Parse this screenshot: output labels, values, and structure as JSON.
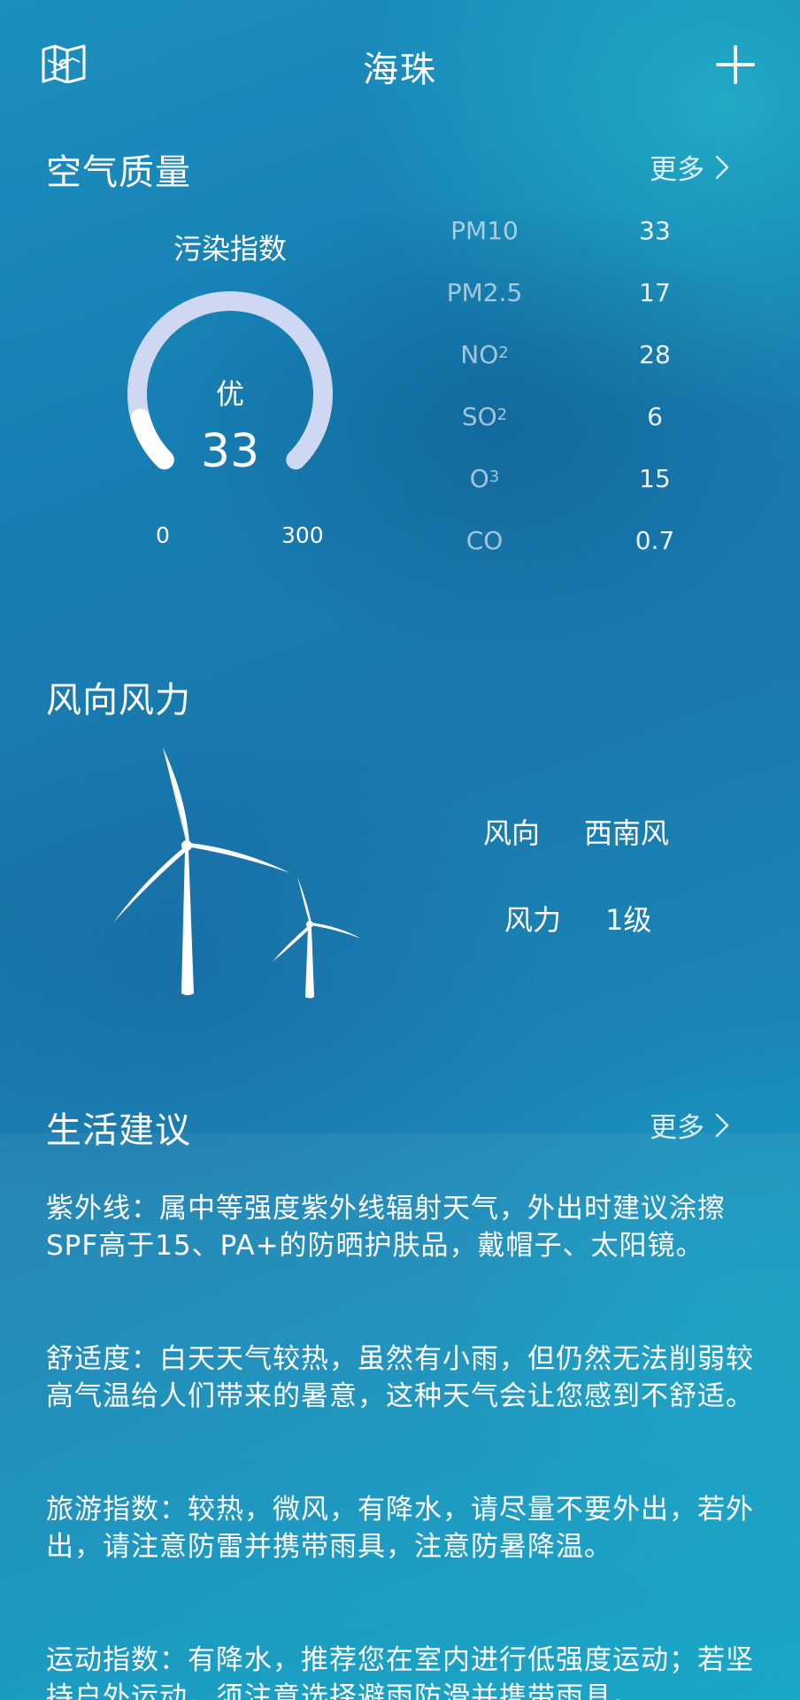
{
  "header": {
    "title": "海珠"
  },
  "air_quality": {
    "section_title": "空气质量",
    "more_label": "更多",
    "index_label": "污染指数",
    "level": "优",
    "value": "33",
    "gauge_min": "0",
    "gauge_max": "300",
    "gauge_fraction": 0.11,
    "pollutants": [
      {
        "name": "PM10",
        "sub": "",
        "value": "33"
      },
      {
        "name": "PM2.5",
        "sub": "",
        "value": "17"
      },
      {
        "name": "NO",
        "sub": "2",
        "value": "28"
      },
      {
        "name": "SO",
        "sub": "2",
        "value": "6"
      },
      {
        "name": "O",
        "sub": "3",
        "value": "15"
      },
      {
        "name": "CO",
        "sub": "",
        "value": "0.7"
      }
    ]
  },
  "wind": {
    "section_title": "风向风力",
    "direction_label": "风向",
    "direction_value": "西南风",
    "force_label": "风力",
    "force_value": "1级"
  },
  "life": {
    "section_title": "生活建议",
    "more_label": "更多",
    "items": [
      "紫外线：属中等强度紫外线辐射天气，外出时建议涂擦SPF高于15、PA+的防晒护肤品，戴帽子、太阳镜。",
      "舒适度：白天天气较热，虽然有小雨，但仍然无法削弱较高气温给人们带来的暑意，这种天气会让您感到不舒适。",
      "旅游指数：较热，微风，有降水，请尽量不要外出，若外出，请注意防雷并携带雨具，注意防暑降温。",
      "运动指数：有降水，推荐您在室内进行低强度运动；若坚持户外运动，须注意选择避雨防滑并携带雨具。"
    ]
  },
  "colors": {
    "gauge_track": "#cfd8f3",
    "gauge_fill": "#ffffff"
  },
  "icons": {
    "map": "map-icon",
    "add": "plus-icon",
    "more": "chevron-right-icon",
    "turbine": "wind-turbine-icon"
  }
}
